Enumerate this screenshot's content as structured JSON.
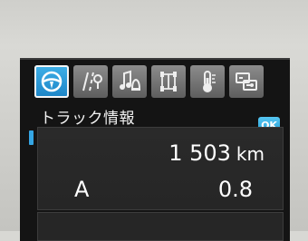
{
  "menu": {
    "tabs": [
      {
        "icon": "steering-wheel-icon"
      },
      {
        "icon": "road-icon"
      },
      {
        "icon": "music-bell-icon"
      },
      {
        "icon": "truck-axle-icon"
      },
      {
        "icon": "temperature-icon"
      },
      {
        "icon": "settings-switch-icon"
      }
    ]
  },
  "header": {
    "title": "トラック情報"
  },
  "ok_label": "OK",
  "odometer": {
    "value": "1 503",
    "unit": "km"
  },
  "trip": {
    "label": "A",
    "value": "0.8"
  },
  "colors": {
    "accent": "#2a9fe0",
    "screen_bg": "#141414"
  }
}
